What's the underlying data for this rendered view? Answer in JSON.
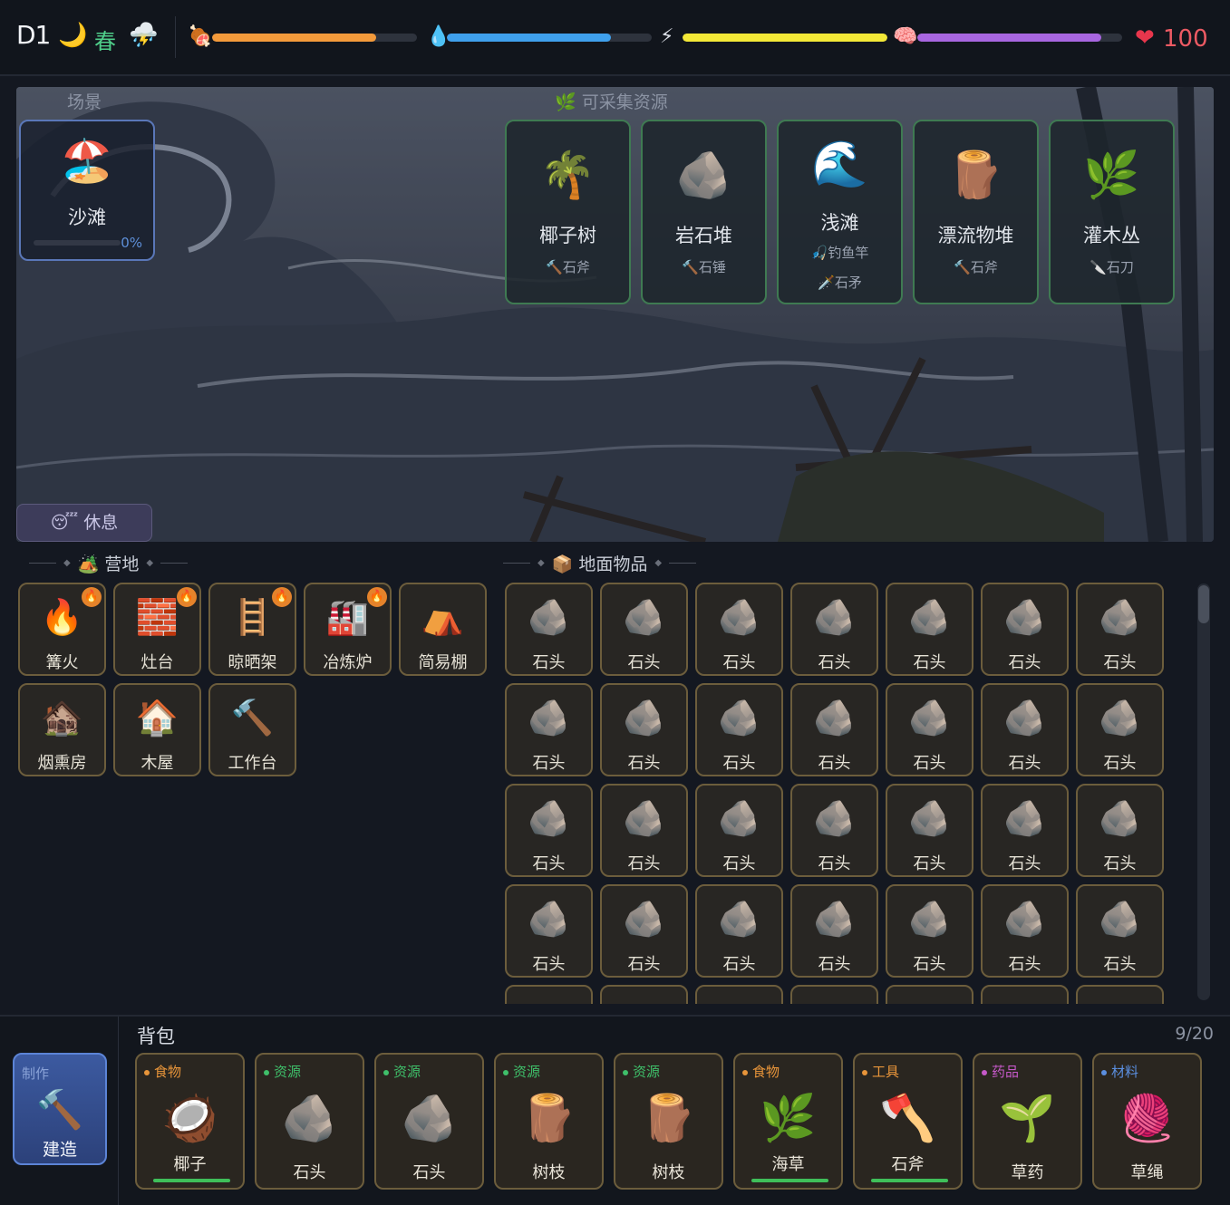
{
  "status": {
    "day": "D1",
    "time_icon": "🌙",
    "season": "春",
    "weather_icon": "⛈️",
    "health": "100",
    "stats": [
      {
        "name": "hunger",
        "icon": "🍖",
        "value": 0.8,
        "color": "#f39a3b"
      },
      {
        "name": "thirst",
        "icon": "💧",
        "value": 0.8,
        "color": "#3fa0ec"
      },
      {
        "name": "energy",
        "icon": "⚡",
        "value": 1.0,
        "color": "#f3e837"
      },
      {
        "name": "sanity",
        "icon": "🧠",
        "value": 0.9,
        "color": "#a866e0"
      }
    ]
  },
  "scene": {
    "label": "场景",
    "location": {
      "icon": "🏖️",
      "name": "沙滩",
      "progress_text": "0%",
      "progress": 0
    },
    "resources_label": "🌿 可采集资源",
    "resources": [
      {
        "icon": "🌴",
        "name": "椰子树",
        "tools": [
          "🔨石斧"
        ]
      },
      {
        "icon": "🪨",
        "name": "岩石堆",
        "tools": [
          "🔨石锤"
        ]
      },
      {
        "icon": "🌊",
        "name": "浅滩",
        "tools": [
          "🎣钓鱼竿",
          "🗡️石矛"
        ]
      },
      {
        "icon": "🪵",
        "name": "漂流物堆",
        "tools": [
          "🔨石斧"
        ]
      },
      {
        "icon": "🌿",
        "name": "灌木丛",
        "tools": [
          "🔪石刀"
        ]
      }
    ],
    "rest_label": "😴 休息"
  },
  "camp": {
    "label": "🏕️ 营地",
    "items": [
      {
        "icon": "🔥",
        "name": "篝火",
        "lit": true
      },
      {
        "icon": "🧱",
        "name": "灶台",
        "lit": true
      },
      {
        "icon": "🪜",
        "name": "晾晒架",
        "lit": true
      },
      {
        "icon": "🏭",
        "name": "冶炼炉",
        "lit": true
      },
      {
        "icon": "⛺",
        "name": "简易棚",
        "lit": false
      },
      {
        "icon": "🏚️",
        "name": "烟熏房",
        "lit": false
      },
      {
        "icon": "🏠",
        "name": "木屋",
        "lit": false
      },
      {
        "icon": "🔨",
        "name": "工作台",
        "lit": false
      }
    ]
  },
  "ground": {
    "label": "📦 地面物品",
    "item_icon": "🪨",
    "items": [
      "石头",
      "石头",
      "石头",
      "石头",
      "石头",
      "石头",
      "石头",
      "石头",
      "石头",
      "石头",
      "石头",
      "石头",
      "石头",
      "石头",
      "石头",
      "石头",
      "石头",
      "石头",
      "石头",
      "石头",
      "石头",
      "石头",
      "石头",
      "石头",
      "石头",
      "石头",
      "石头",
      "石头"
    ]
  },
  "backpack": {
    "title": "背包",
    "count": "9/20",
    "craft": {
      "tag": "制作",
      "icon": "🔨",
      "label": "建造"
    },
    "items": [
      {
        "cat": "食物",
        "cat_color": "#e8953a",
        "icon": "🥥",
        "name": "椰子",
        "durability": true
      },
      {
        "cat": "资源",
        "cat_color": "#3fbf6a",
        "icon": "🪨",
        "name": "石头",
        "durability": false
      },
      {
        "cat": "资源",
        "cat_color": "#3fbf6a",
        "icon": "🪨",
        "name": "石头",
        "durability": false
      },
      {
        "cat": "资源",
        "cat_color": "#3fbf6a",
        "icon": "🪵",
        "name": "树枝",
        "durability": false
      },
      {
        "cat": "资源",
        "cat_color": "#3fbf6a",
        "icon": "🪵",
        "name": "树枝",
        "durability": false
      },
      {
        "cat": "食物",
        "cat_color": "#e8953a",
        "icon": "🌿",
        "name": "海草",
        "durability": true
      },
      {
        "cat": "工具",
        "cat_color": "#e8953a",
        "icon": "🪓",
        "name": "石斧",
        "durability": true
      },
      {
        "cat": "药品",
        "cat_color": "#c659c9",
        "icon": "🌱",
        "name": "草药",
        "durability": false
      },
      {
        "cat": "材料",
        "cat_color": "#5b8fe0",
        "icon": "🧶",
        "name": "草绳",
        "durability": false
      }
    ]
  }
}
